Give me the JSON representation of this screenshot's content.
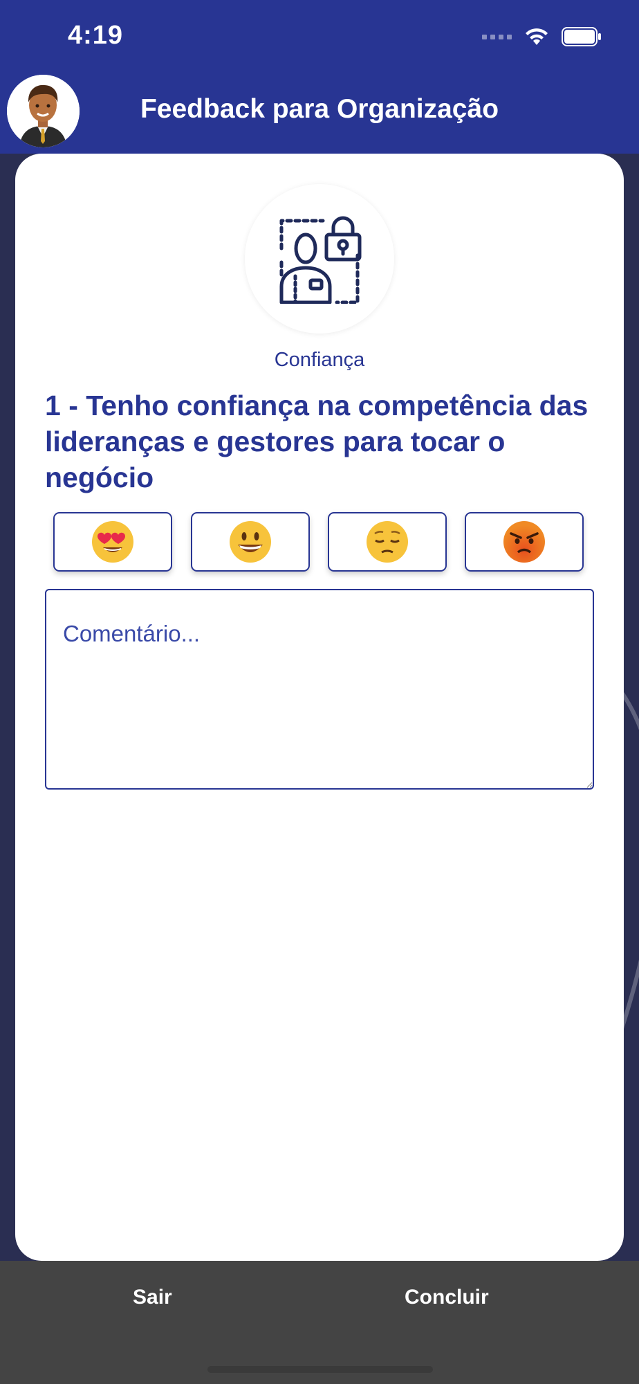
{
  "status_bar": {
    "time": "4:19"
  },
  "header": {
    "title": "Feedback para Organização"
  },
  "question_card": {
    "category_icon": "trust-lock-person-icon",
    "category_label": "Confiança",
    "question_text": "1 - Tenho confiança na competência das lideranças e gestores para tocar o negócio",
    "rating_options": [
      {
        "icon": "heart-eyes-face-icon",
        "emoji": "😍"
      },
      {
        "icon": "smiling-face-icon",
        "emoji": "😃"
      },
      {
        "icon": "sad-face-icon",
        "emoji": "😔"
      },
      {
        "icon": "angry-face-icon",
        "emoji": "😡"
      }
    ],
    "comment_placeholder": "Comentário..."
  },
  "footer": {
    "exit_label": "Sair",
    "finish_label": "Concluir"
  },
  "colors": {
    "primary": "#283593",
    "footer": "#444444",
    "background": "#2a2e52"
  }
}
